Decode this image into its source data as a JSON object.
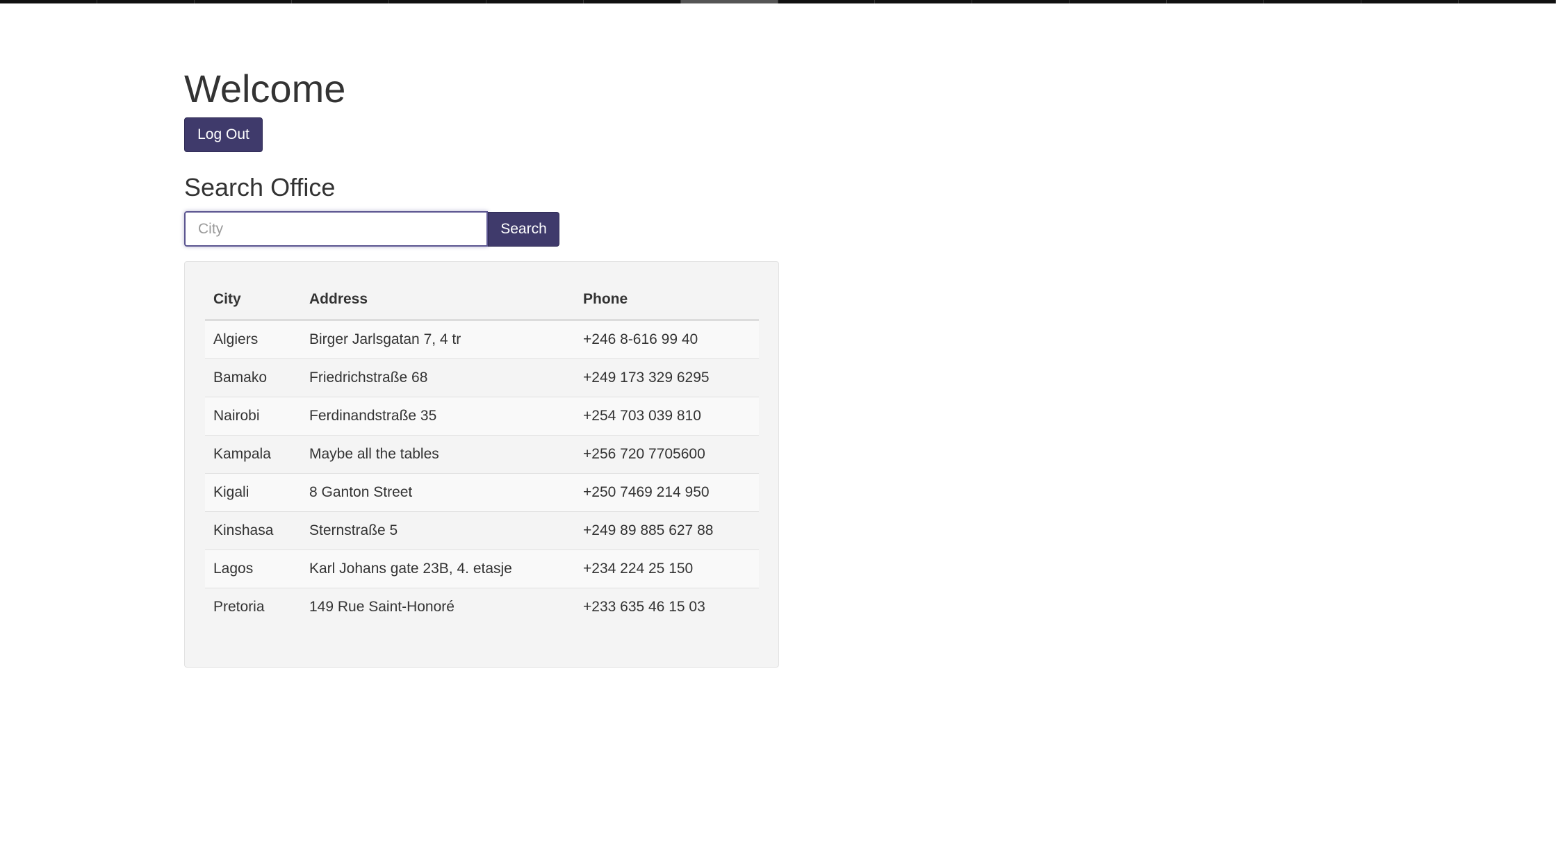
{
  "header": {
    "title": "Welcome",
    "logout_label": "Log Out"
  },
  "search": {
    "title": "Search Office",
    "placeholder": "City",
    "button_label": "Search"
  },
  "table": {
    "columns": [
      "City",
      "Address",
      "Phone"
    ],
    "rows": [
      {
        "city": "Algiers",
        "address": "Birger Jarlsgatan 7, 4 tr",
        "phone": "+246 8-616 99 40"
      },
      {
        "city": "Bamako",
        "address": "Friedrichstraße 68",
        "phone": "+249 173 329 6295"
      },
      {
        "city": "Nairobi",
        "address": "Ferdinandstraße 35",
        "phone": "+254 703 039 810"
      },
      {
        "city": "Kampala",
        "address": "Maybe all the tables",
        "phone": "+256 720 7705600"
      },
      {
        "city": "Kigali",
        "address": "8 Ganton Street",
        "phone": "+250 7469 214 950"
      },
      {
        "city": "Kinshasa",
        "address": "Sternstraße 5",
        "phone": "+249 89 885 627 88"
      },
      {
        "city": "Lagos",
        "address": "Karl Johans gate 23B, 4. etasje",
        "phone": "+234 224 25 150"
      },
      {
        "city": "Pretoria",
        "address": "149 Rue Saint-Honoré",
        "phone": "+233 635 46 15 03"
      }
    ]
  },
  "colors": {
    "accent": "#3f3a6b",
    "panel_bg": "#f4f4f4",
    "text": "#333333"
  }
}
